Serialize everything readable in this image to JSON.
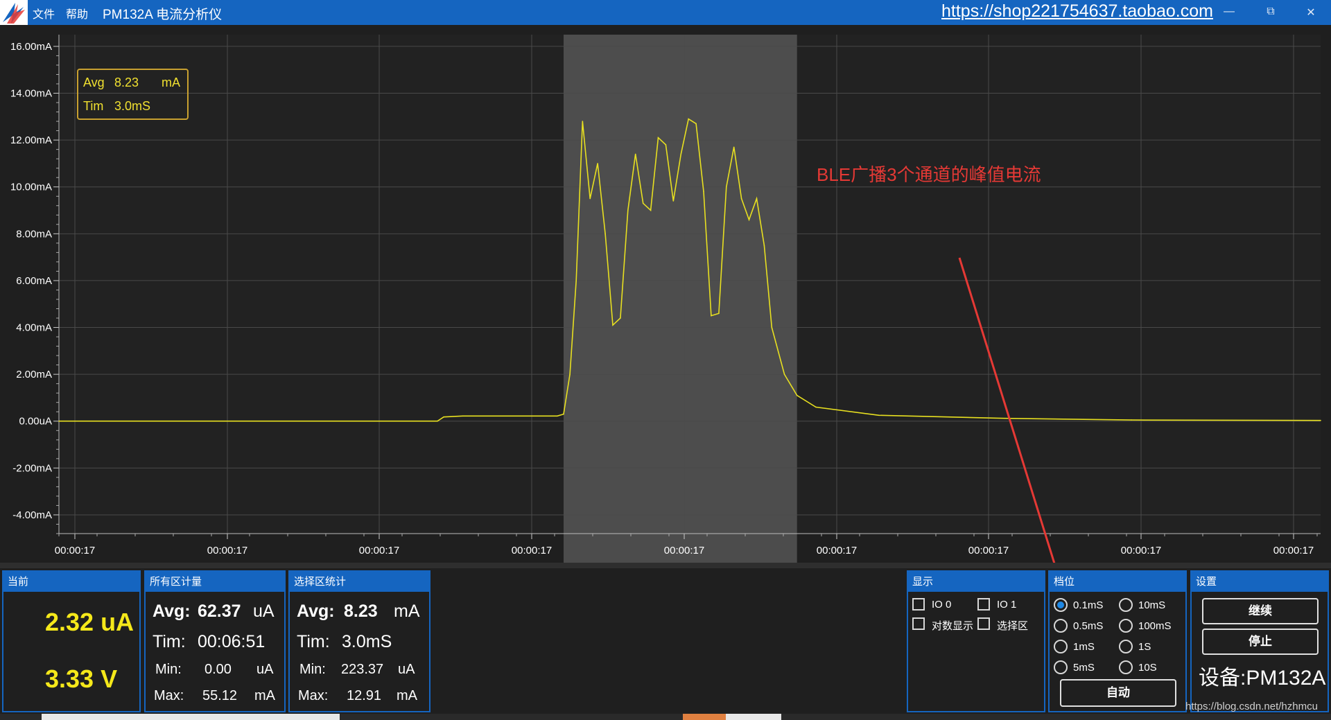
{
  "titlebar": {
    "menu_file": "文件",
    "menu_help": "帮助",
    "title": "PM132A 电流分析仪",
    "url": "https://shop221754637.taobao.com",
    "minimize_glyph": "—",
    "restore_glyph": "⧉",
    "close_glyph": "✕"
  },
  "chart": {
    "y_ticks": [
      "16.00mA",
      "14.00mA",
      "12.00mA",
      "10.00mA",
      "8.00mA",
      "6.00mA",
      "4.00mA",
      "2.00mA",
      "0.00uA",
      "-2.00mA",
      "-4.00mA"
    ],
    "x_ticks": [
      "00:00:17",
      "00:00:17",
      "00:00:17",
      "00:00:17",
      "00:00:17",
      "00:00:17",
      "00:00:17",
      "00:00:17",
      "00:00:17"
    ],
    "annotation": "BLE广播3个通道的峰值电流",
    "info_avg_label": "Avg",
    "info_avg_value": "8.23",
    "info_avg_unit": "mA",
    "info_tim_label": "Tim",
    "info_tim_value": "3.0mS",
    "line_color": "#e8e020",
    "selection_color": "#555555",
    "arrow_color": "#e53935"
  },
  "chart_data": {
    "type": "line",
    "ylabel": "",
    "xlabel": "",
    "ylim": [
      -4.8,
      16.5
    ],
    "xlim": [
      0,
      1
    ],
    "y_unit": "mA",
    "grid": true,
    "selection_range": [
      0.4,
      0.585
    ],
    "series": [
      {
        "color": "#e8e020",
        "points": [
          [
            0.0,
            0.0
          ],
          [
            0.3,
            0.0
          ],
          [
            0.305,
            0.18
          ],
          [
            0.32,
            0.22
          ],
          [
            0.395,
            0.22
          ],
          [
            0.4,
            0.3
          ],
          [
            0.405,
            2.0
          ],
          [
            0.41,
            6.0
          ],
          [
            0.415,
            12.8
          ],
          [
            0.421,
            9.5
          ],
          [
            0.427,
            11.0
          ],
          [
            0.433,
            8.0
          ],
          [
            0.439,
            4.1
          ],
          [
            0.445,
            4.4
          ],
          [
            0.451,
            9.0
          ],
          [
            0.457,
            11.4
          ],
          [
            0.463,
            9.3
          ],
          [
            0.469,
            9.0
          ],
          [
            0.475,
            12.1
          ],
          [
            0.481,
            11.8
          ],
          [
            0.487,
            9.4
          ],
          [
            0.493,
            11.4
          ],
          [
            0.499,
            12.9
          ],
          [
            0.505,
            12.7
          ],
          [
            0.511,
            9.8
          ],
          [
            0.517,
            4.5
          ],
          [
            0.523,
            4.6
          ],
          [
            0.529,
            10.0
          ],
          [
            0.535,
            11.7
          ],
          [
            0.541,
            9.5
          ],
          [
            0.547,
            8.6
          ],
          [
            0.553,
            9.5
          ],
          [
            0.559,
            7.5
          ],
          [
            0.565,
            4.0
          ],
          [
            0.575,
            2.0
          ],
          [
            0.585,
            1.1
          ],
          [
            0.6,
            0.6
          ],
          [
            0.65,
            0.25
          ],
          [
            0.75,
            0.12
          ],
          [
            0.85,
            0.05
          ],
          [
            1.0,
            0.03
          ]
        ]
      }
    ]
  },
  "panels": {
    "current": {
      "title": "当前",
      "current": "2.32 uA",
      "voltage": "3.33 V"
    },
    "all": {
      "title": "所有区计量",
      "avg_label": "Avg:",
      "avg_value": "62.37",
      "avg_unit": "uA",
      "tim_label": "Tim:",
      "tim_value": "00:06:51",
      "min_label": "Min:",
      "min_value": "0.00",
      "min_unit": "uA",
      "max_label": "Max:",
      "max_value": "55.12",
      "max_unit": "mA"
    },
    "selection": {
      "title": "选择区统计",
      "avg_label": "Avg:",
      "avg_value": "8.23",
      "avg_unit": "mA",
      "tim_label": "Tim:",
      "tim_value": "3.0mS",
      "min_label": "Min:",
      "min_value": "223.37",
      "min_unit": "uA",
      "max_label": "Max:",
      "max_value": "12.91",
      "max_unit": "mA"
    },
    "display": {
      "title": "显示",
      "io0": "IO 0",
      "io1": "IO 1",
      "log": "对数显示",
      "sel": "选择区"
    },
    "gear": {
      "title": "档位",
      "options": [
        "0.1mS",
        "10mS",
        "0.5mS",
        "100mS",
        "1mS",
        "1S",
        "5mS",
        "10S"
      ],
      "selected": "0.1mS",
      "auto": "自动"
    },
    "settings": {
      "title": "设置",
      "continue": "继续",
      "stop": "停止",
      "device": "设备:PM132A"
    }
  },
  "watermark": "https://blog.csdn.net/hzhmcu"
}
